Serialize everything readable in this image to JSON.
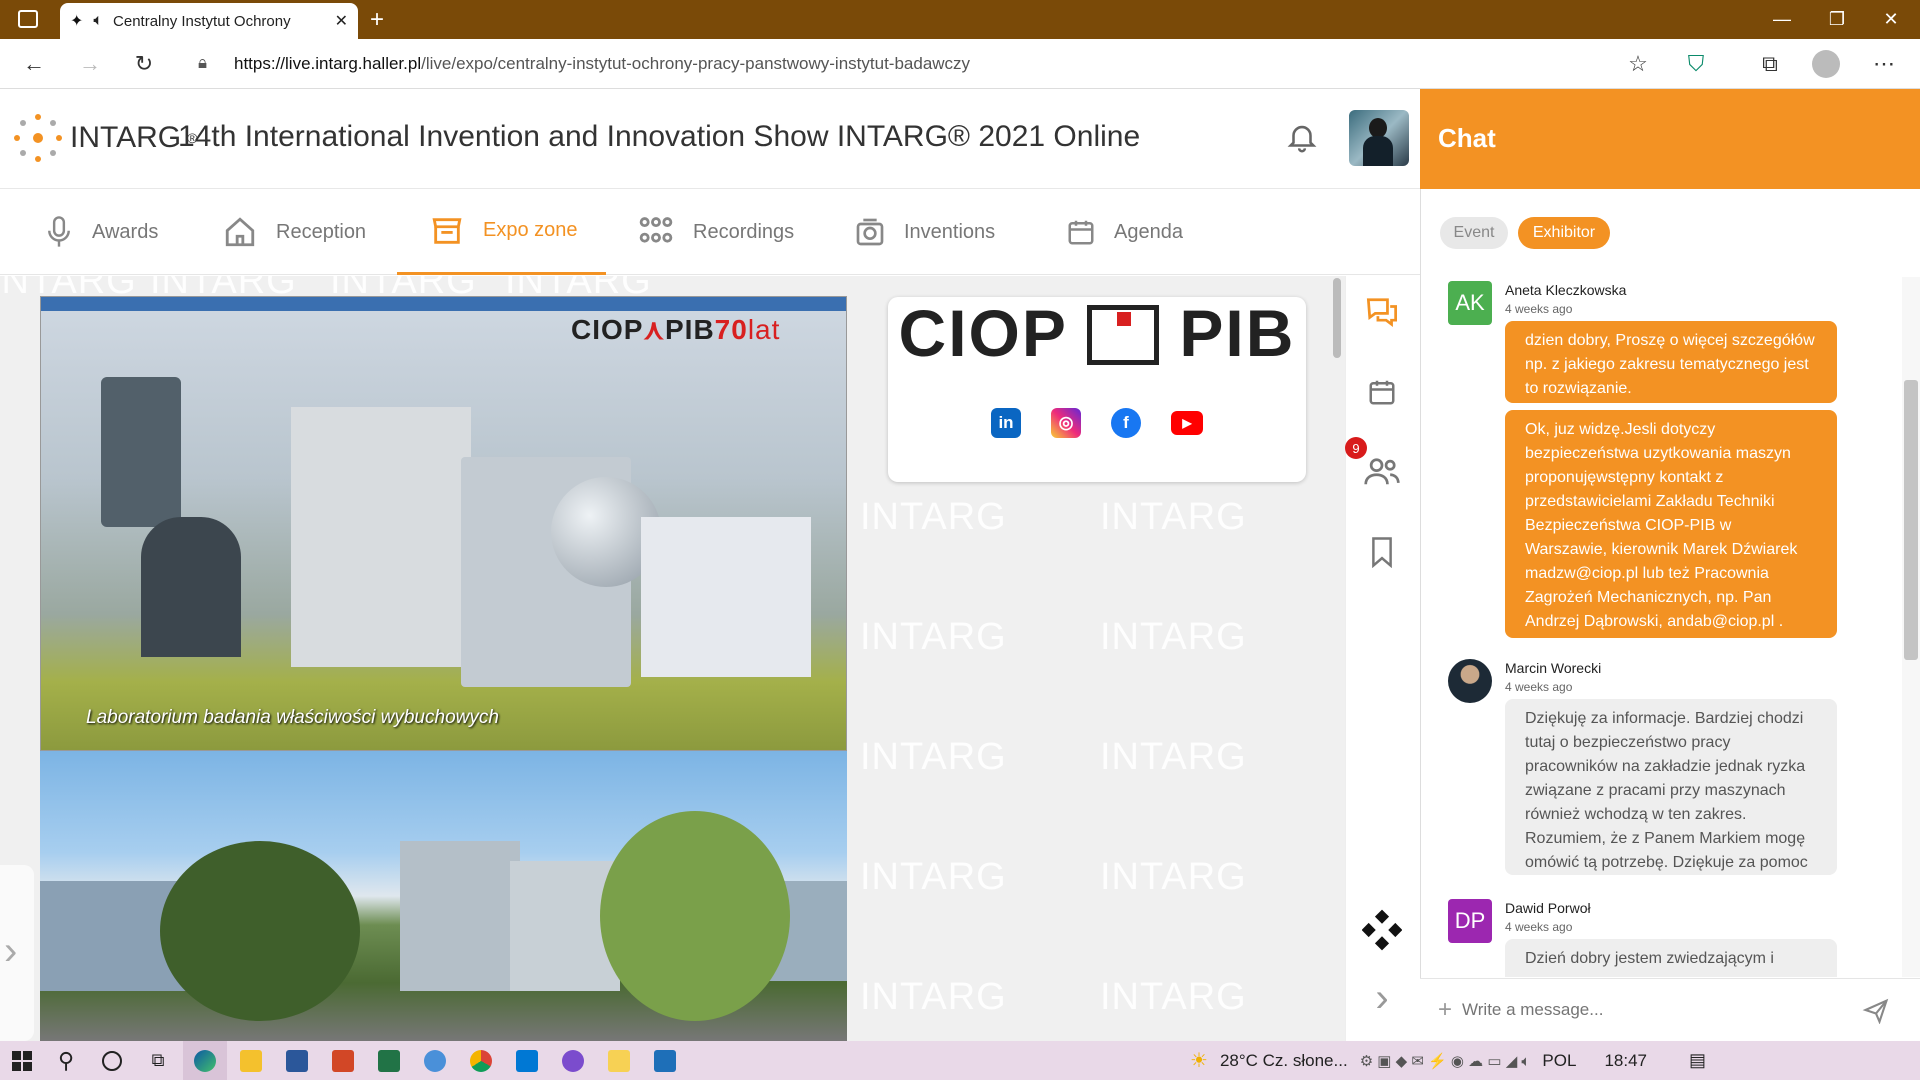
{
  "browser": {
    "tab_title": "Centralny Instytut Ochrony",
    "url_domain": "https://live.intarg.haller.pl",
    "url_path": "/live/expo/centralny-instytut-ochrony-pracy-panstwowy-instytut-badawczy"
  },
  "header": {
    "logo_text": "INTARG",
    "logo_reg": "®",
    "event_title": "14th International Invention and Innovation Show INTARG® 2021 Online"
  },
  "nav": {
    "items": [
      {
        "label": "Awards",
        "icon": "microphone-icon"
      },
      {
        "label": "Reception",
        "icon": "home-icon"
      },
      {
        "label": "Expo zone",
        "icon": "store-icon",
        "active": true
      },
      {
        "label": "Recordings",
        "icon": "people-grid-icon"
      },
      {
        "label": "Inventions",
        "icon": "inventions-icon"
      },
      {
        "label": "Agenda",
        "icon": "calendar-icon"
      }
    ]
  },
  "expo": {
    "watermark": "INTARG",
    "photo_caption": "Laboratorium badania właściwości wybuchowych",
    "photo_logo": "CIOP",
    "photo_logo_pib": "PIB",
    "photo_logo_years": "70",
    "photo_logo_lat": "lat",
    "card_left": "CIOP",
    "card_right": "PIB",
    "social": [
      {
        "name": "linkedin",
        "label": "in",
        "color": "#0a66c2"
      },
      {
        "name": "instagram",
        "label": "◎",
        "color": "#c13584"
      },
      {
        "name": "facebook",
        "label": "f",
        "color": "#1877f2"
      },
      {
        "name": "youtube",
        "label": "▶",
        "color": "#ff0000"
      }
    ]
  },
  "rail": {
    "badge": "9"
  },
  "chat": {
    "title": "Chat",
    "tabs": [
      "Event",
      "Exhibitor"
    ],
    "active_tab": "Exhibitor",
    "messages": [
      {
        "initials": "AK",
        "name": "Aneta Kleczkowska",
        "time": "4 weeks ago",
        "avatar_color": "#4caf50",
        "bubbles": [
          "dzien dobry, Proszę o więcej szczegółów np. z jakiego zakresu tematycznego jest to rozwiązanie.",
          "Ok, juz widzę.Jesli dotyczy bezpieczeństwa uzytkowania maszyn proponujęwstępny kontakt z przedstawicielami Zakładu Techniki Bezpieczeństwa CIOP-PIB w Warszawie, kierownik Marek Dźwiarek madzw@ciop.pl lub też Pracownia Zagrożeń Mechanicznych, np. Pan Andrzej Dąbrowski, andab@ciop.pl ."
        ]
      },
      {
        "initials": "",
        "name": "Marcin Worecki",
        "time": "4 weeks ago",
        "bubbles": [
          "Dziękuję za informacje. Bardziej chodzi tutaj o bezpieczeństwo pracy pracowników na zakładzie jednak ryzka związane z pracami przy maszynach również wchodzą w ten zakres. Rozumiem, że z Panem Markiem mogę omówić tą potrzebę. Dziękuje za pomoc"
        ]
      },
      {
        "initials": "DP",
        "name": "Dawid Porwoł",
        "time": "4 weeks ago",
        "avatar_color": "#9c27b0",
        "bubbles": [
          "Dzień dobry jestem zwiedzającym i"
        ]
      }
    ],
    "compose_placeholder": "Write a message..."
  },
  "taskbar": {
    "weather": "28°C  Cz. słone...",
    "lang": "POL",
    "time": "18:47"
  }
}
